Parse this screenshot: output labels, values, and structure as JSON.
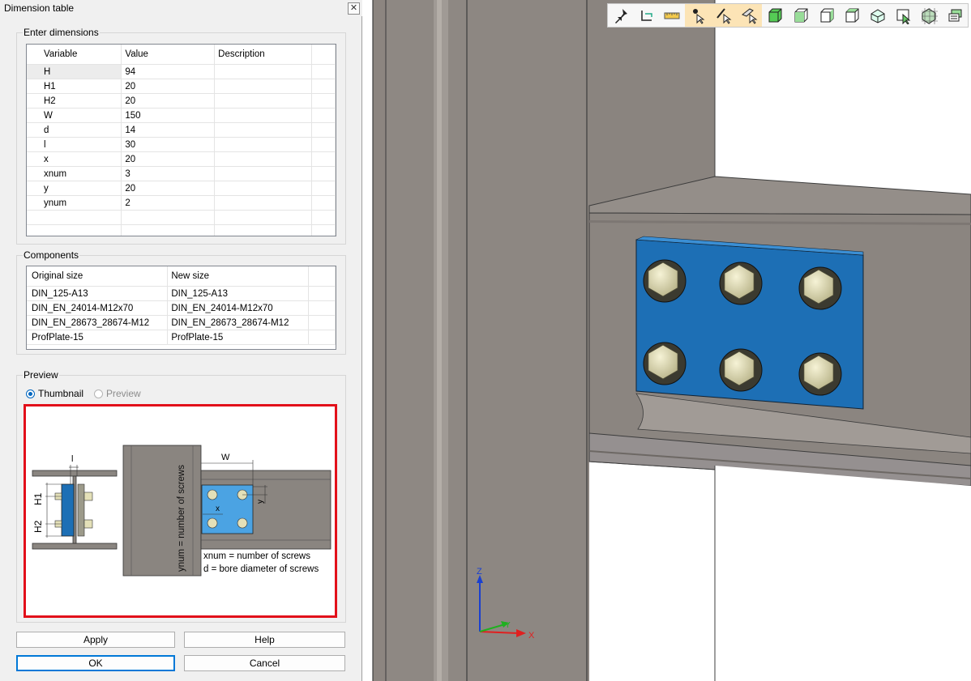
{
  "dialog": {
    "title": "Dimension table",
    "close_glyph": "✕",
    "enter_dimensions": {
      "legend": "Enter dimensions",
      "columns": [
        "Variable",
        "Value",
        "Description"
      ],
      "rows": [
        {
          "variable": "H",
          "value": "94",
          "description": ""
        },
        {
          "variable": "H1",
          "value": "20",
          "description": ""
        },
        {
          "variable": "H2",
          "value": "20",
          "description": ""
        },
        {
          "variable": "W",
          "value": "150",
          "description": ""
        },
        {
          "variable": "d",
          "value": "14",
          "description": ""
        },
        {
          "variable": "l",
          "value": "30",
          "description": ""
        },
        {
          "variable": "x",
          "value": "20",
          "description": ""
        },
        {
          "variable": "xnum",
          "value": "3",
          "description": ""
        },
        {
          "variable": "y",
          "value": "20",
          "description": ""
        },
        {
          "variable": "ynum",
          "value": "2",
          "description": ""
        }
      ]
    },
    "components": {
      "legend": "Components",
      "columns": [
        "Original size",
        "New size"
      ],
      "rows": [
        {
          "original": "DIN_125-A13",
          "new": "DIN_125-A13"
        },
        {
          "original": "DIN_EN_24014-M12x70",
          "new": "DIN_EN_24014-M12x70"
        },
        {
          "original": "DIN_EN_28673_28674-M12",
          "new": "DIN_EN_28673_28674-M12"
        },
        {
          "original": "ProfPlate-15",
          "new": "ProfPlate-15"
        }
      ]
    },
    "preview": {
      "legend": "Preview",
      "option_thumbnail": "Thumbnail",
      "option_preview": "Preview",
      "selected": "Thumbnail",
      "drawing": {
        "label_l": "l",
        "label_h1": "H1",
        "label_h2": "H2",
        "label_w": "W",
        "label_x": "x",
        "label_y": "y",
        "label_ynum": "ynum = number of screws",
        "label_xnum": "xnum = number of screws",
        "label_d": "d = bore diameter of screws"
      }
    },
    "buttons": {
      "apply": "Apply",
      "help": "Help",
      "ok": "OK",
      "cancel": "Cancel"
    }
  },
  "viewport": {
    "toolbar_icons": [
      "pin-icon",
      "rotate-view-icon",
      "ruler-icon",
      "select-point-icon",
      "select-edge-icon",
      "select-face-icon",
      "box-solid-icon",
      "box-wire-icon",
      "box-front-icon",
      "box-side-icon",
      "box-shaded-icon",
      "box-select-icon",
      "box-grid-icon",
      "layers-icon"
    ],
    "active_toolbar_icons": [
      "select-point-icon",
      "select-edge-icon",
      "select-face-icon"
    ],
    "axis": {
      "z": "Z",
      "y": "Y",
      "x": "X"
    },
    "colors": {
      "steel": "#8c8580",
      "plate": "#1d6fb5",
      "bolt": "#e4e0b8",
      "x_axis": "#e02020",
      "y_axis": "#20b020",
      "z_axis": "#1a40d0",
      "highlight": "#e2101a"
    }
  }
}
